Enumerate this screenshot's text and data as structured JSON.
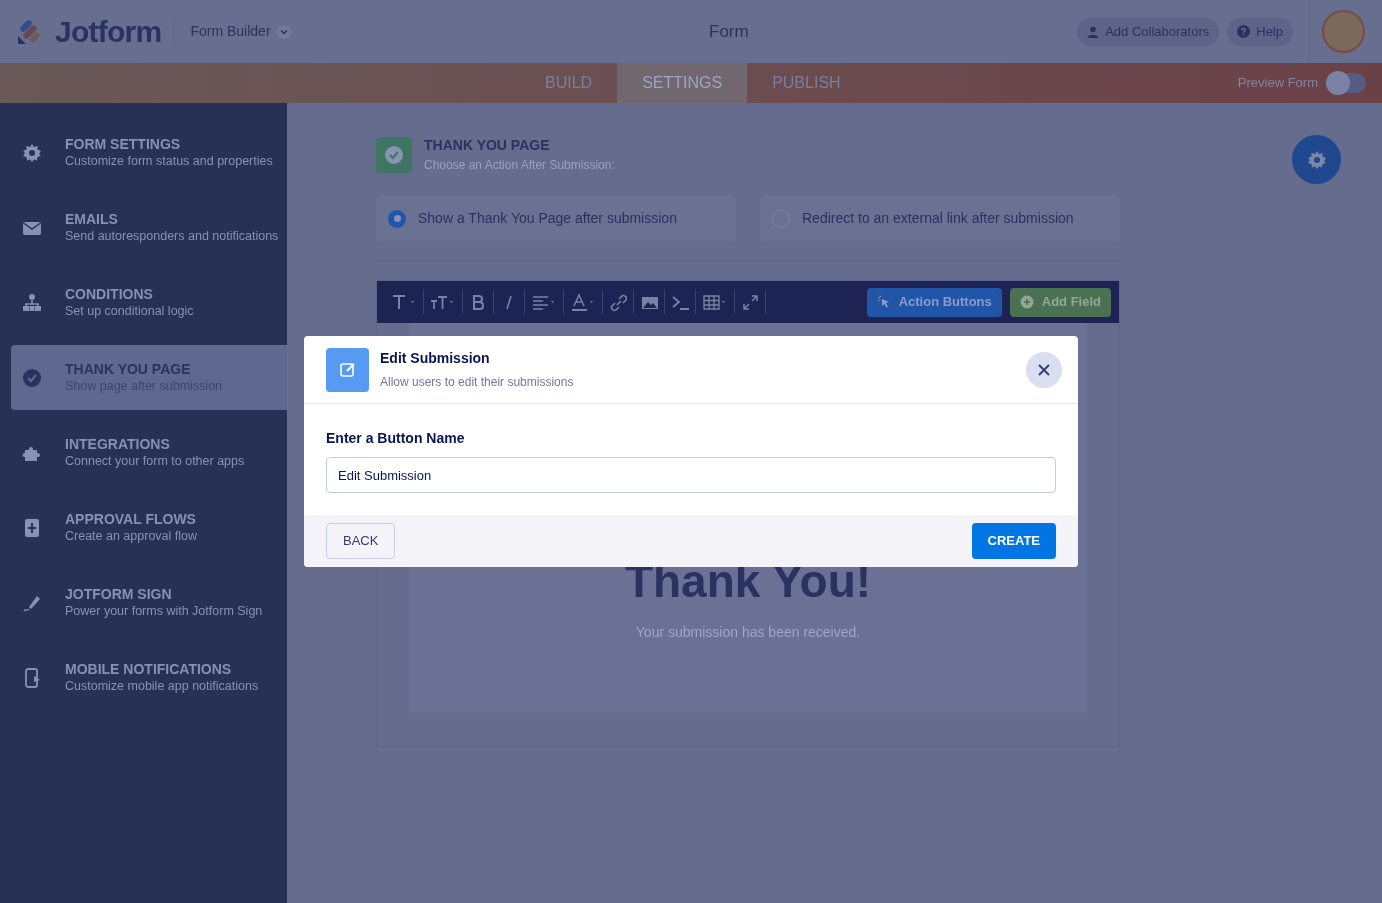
{
  "header": {
    "logo": "Jotform",
    "builder": "Form Builder",
    "title": "Form",
    "buttons": [
      {
        "kind": "collaborators",
        "label": "Add Collaborators"
      },
      {
        "kind": "help",
        "label": "Help"
      }
    ]
  },
  "tabs": [
    {
      "label": "BUILD",
      "selected": false
    },
    {
      "label": "SETTINGS",
      "selected": true
    },
    {
      "label": "PUBLISH",
      "selected": false
    }
  ],
  "preview": {
    "label": "Preview Form",
    "on": false
  },
  "sidebar": {
    "items": [
      {
        "kind": "gear",
        "title": "FORM SETTINGS",
        "subtitle": "Customize form status and properties",
        "selected": false
      },
      {
        "kind": "mail",
        "title": "EMAILS",
        "subtitle": "Send autoresponders and notifications",
        "selected": false
      },
      {
        "kind": "tree",
        "title": "CONDITIONS",
        "subtitle": "Set up conditional logic",
        "selected": false
      },
      {
        "kind": "check",
        "title": "THANK YOU PAGE",
        "subtitle": "Show page after submission",
        "selected": true
      },
      {
        "kind": "puzzle",
        "title": "INTEGRATIONS",
        "subtitle": "Connect your form to other apps",
        "selected": false
      },
      {
        "kind": "flow",
        "title": "APPROVAL FLOWS",
        "subtitle": "Create an approval flow",
        "selected": false
      },
      {
        "kind": "pen",
        "title": "JOTFORM SIGN",
        "subtitle": "Power your forms with Jotform Sign",
        "selected": false
      },
      {
        "kind": "phone",
        "title": "MOBILE NOTIFICATIONS",
        "subtitle": "Customize mobile app notifications",
        "selected": false
      }
    ]
  },
  "section": {
    "title": "THANK YOU PAGE",
    "subtitle": "Choose an Action After Submission:",
    "options": [
      {
        "label": "Show a Thank You Page after submission",
        "selected": true
      },
      {
        "label": "Redirect to an external link after submission",
        "selected": false
      }
    ]
  },
  "editor": {
    "action_buttons": "Action Buttons",
    "add_field": "Add Field",
    "heading": "Thank You!",
    "message": "Your submission has been received."
  },
  "modal": {
    "title": "Edit Submission",
    "subtitle": "Allow users to edit their submissions",
    "field_label": "Enter a Button Name",
    "field_value": "Edit Submission",
    "back": "BACK",
    "create": "CREATE"
  }
}
